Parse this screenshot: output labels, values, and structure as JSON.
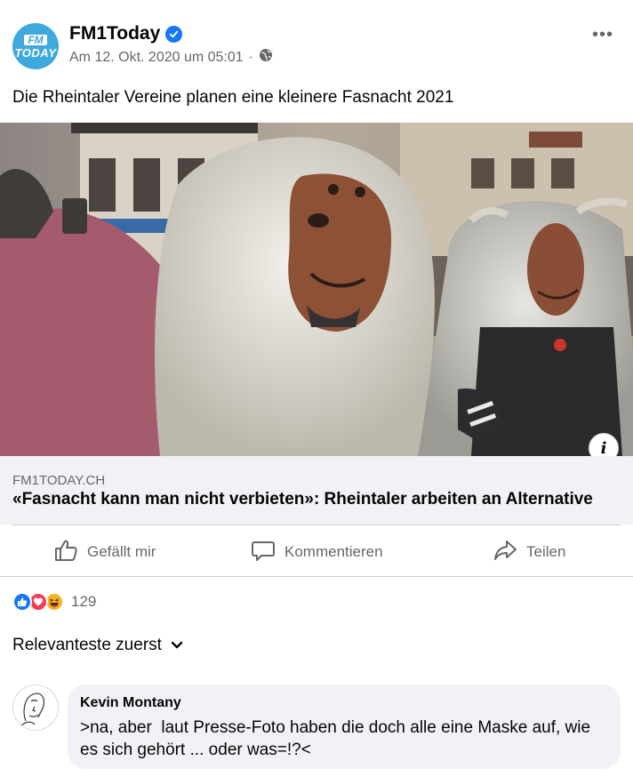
{
  "post": {
    "page_name": "FM1Today",
    "avatar_line1": "FM",
    "avatar_line2": "TODAY",
    "timestamp": "Am 12. Okt. 2020 um 05:01",
    "separator": "·",
    "more_label": "•••",
    "text": "Die Rheintaler Vereine planen eine kleinere Fasnacht 2021"
  },
  "link": {
    "domain": "FM1TODAY.CH",
    "title": "«Fasnacht kann man nicht verbieten»: Rheintaler arbeiten an Alternative",
    "info_label": "i"
  },
  "actions": {
    "like": "Gefällt mir",
    "comment": "Kommentieren",
    "share": "Teilen"
  },
  "reactions": {
    "count": "129",
    "types": [
      "like-icon",
      "love-icon",
      "haha-icon"
    ],
    "colors": {
      "like": "#1877f2",
      "love": "#f33e58",
      "haha": "#f7b125"
    }
  },
  "comments": {
    "sort_label": "Relevanteste zuerst",
    "items": [
      {
        "author": "Kevin Montany",
        "text": ">na, aber  laut Presse-Foto haben die doch alle eine Maske auf, wie es sich gehört ... oder was=!?<"
      }
    ]
  },
  "colors": {
    "brand_blue": "#1877f2",
    "avatar_bg": "#3fa9dd",
    "secondary_text": "#65676b"
  }
}
